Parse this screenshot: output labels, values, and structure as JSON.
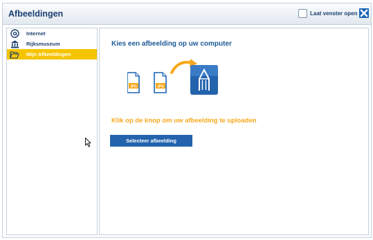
{
  "window": {
    "title": "Afbeeldingen",
    "keep_open_label": "Laat venster open",
    "keep_open_checked": false,
    "close_icon": "close-icon"
  },
  "sidebar": {
    "items": [
      {
        "label": "Internet",
        "icon": "at-sign-icon",
        "selected": false
      },
      {
        "label": "Rijksmuseum",
        "icon": "museum-icon",
        "selected": false
      },
      {
        "label": "Mijn Afbeeldingen",
        "icon": "folder-open-icon",
        "selected": true
      }
    ]
  },
  "main": {
    "heading": "Kies een afbeelding op uw computer",
    "file_badges": [
      "JPG",
      "JPG"
    ],
    "instruction": "Klik op de knop om uw afbeelding te uploaden",
    "select_button_label": "Selecteer afbeelding"
  },
  "colors": {
    "accent_blue": "#2363ad",
    "selected_yellow": "#f5c400",
    "instruction_orange": "#f7a81b",
    "title_navy": "#1c3f6e"
  }
}
